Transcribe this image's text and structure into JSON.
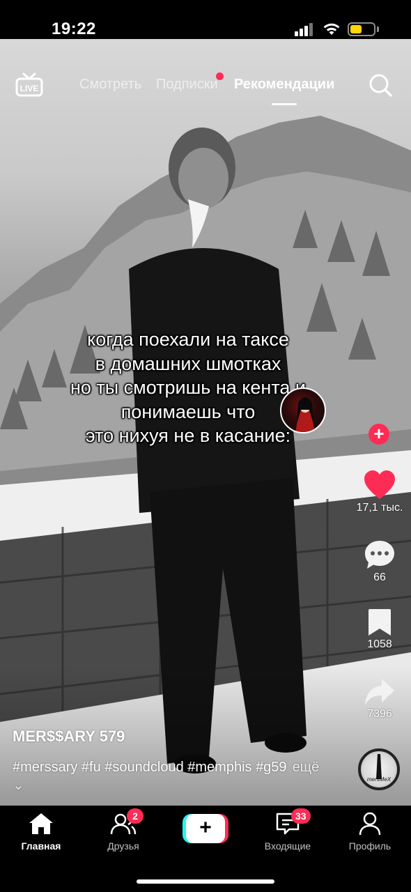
{
  "status_bar": {
    "time": "19:22"
  },
  "top_tabs": {
    "live_label": "LIVE",
    "watch": "Смотреть",
    "subscriptions": "Подписки",
    "recommendations": "Рекомендации",
    "active": "recommendations"
  },
  "video": {
    "caption_lines": [
      "когда поехали на таксе",
      "в домашних шмотках",
      "но ты смотришь на кента и",
      "понимаешь что",
      "это нихуя не в касание:"
    ],
    "author": "MER$$ARY 579",
    "description": "#merssary #fu #soundcloud #memphis #g59",
    "more_label": "ещё",
    "music_label": "mersMeX"
  },
  "actions": {
    "likes": "17,1 тыс.",
    "comments": "66",
    "saves": "1058",
    "shares": "7396"
  },
  "bottom_nav": {
    "home": "Главная",
    "friends": "Друзья",
    "friends_badge": "2",
    "inbox": "Входящие",
    "inbox_badge": "33",
    "profile": "Профиль",
    "create": "+"
  },
  "colors": {
    "accent": "#fe2c55",
    "cyan": "#25f4ee",
    "battery": "#ffd60a"
  }
}
